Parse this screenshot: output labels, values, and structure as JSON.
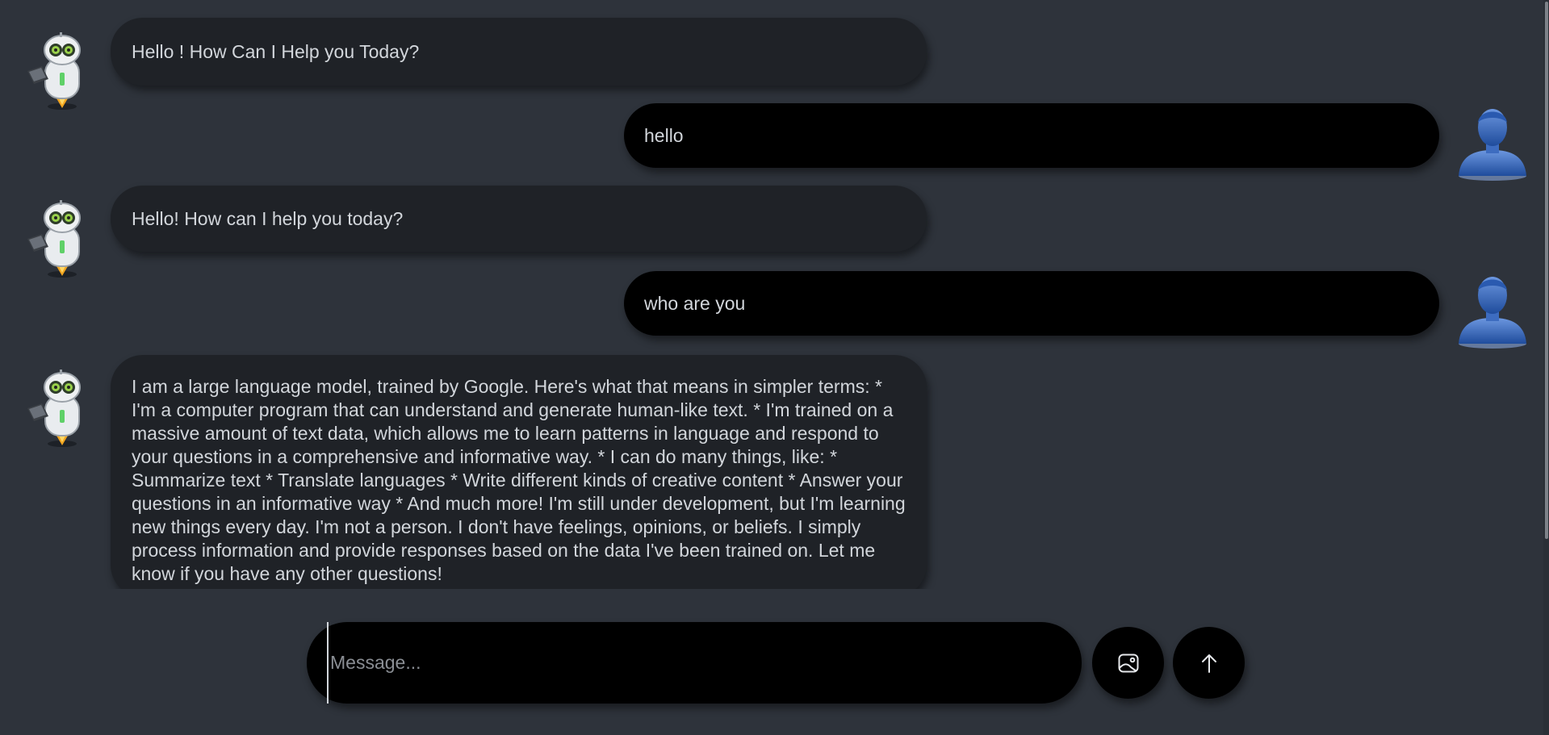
{
  "messages": [
    {
      "role": "bot",
      "text": "Hello ! How Can I Help you Today?"
    },
    {
      "role": "user",
      "text": "hello"
    },
    {
      "role": "bot",
      "text": "Hello! How can I help you today?"
    },
    {
      "role": "user",
      "text": "who are you"
    },
    {
      "role": "bot",
      "text": "I am a large language model, trained by Google. Here's what that means in simpler terms: * I'm a computer program that can understand and generate human-like text. * I'm trained on a massive amount of text data, which allows me to learn patterns in language and respond to your questions in a comprehensive and informative way. * I can do many things, like: * Summarize text * Translate languages * Write different kinds of creative content * Answer your questions in an informative way * And much more! I'm still under development, but I'm learning new things every day. I'm not a person. I don't have feelings, opinions, or beliefs. I simply process information and provide responses based on the data I've been trained on. Let me know if you have any other questions!"
    }
  ],
  "composer": {
    "placeholder": "Message...",
    "value": ""
  },
  "icons": {
    "bot_avatar": "robot-avatar-icon",
    "user_avatar": "user-avatar-icon",
    "image_button": "image-upload-icon",
    "send_button": "arrow-up-icon"
  },
  "colors": {
    "background": "#2e333b",
    "bot_bubble": "#1f2227",
    "user_bubble": "#000000",
    "text": "#d2d6db"
  }
}
